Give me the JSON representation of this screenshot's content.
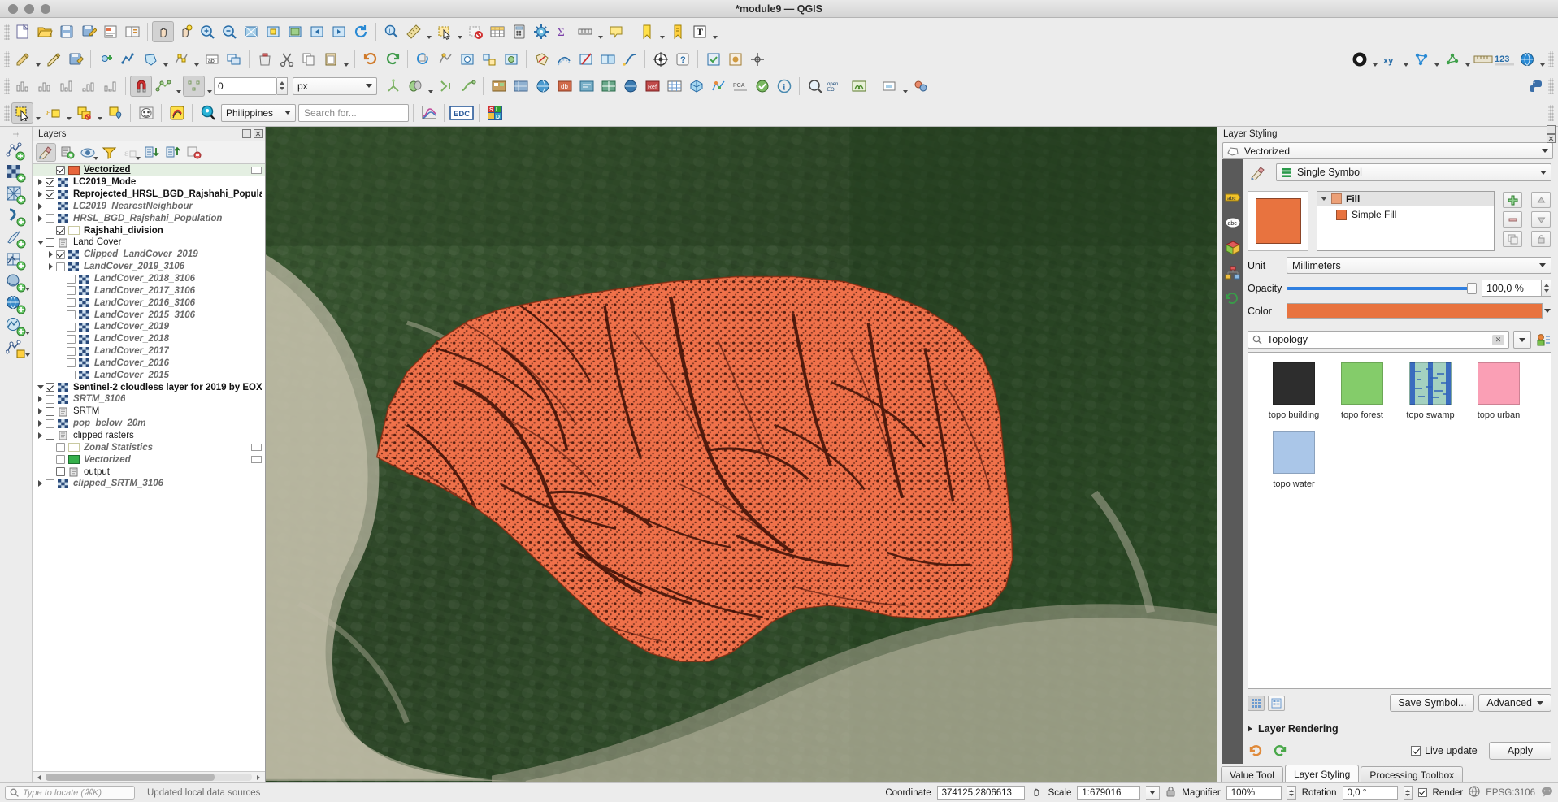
{
  "window": {
    "title": "*module9 — QGIS",
    "traffic_lights": [
      "close",
      "minimize",
      "zoom"
    ]
  },
  "toolbar_row3": {
    "offset_value": "0",
    "units": "px"
  },
  "toolbar_row4": {
    "location_filter": "Philippines",
    "search_placeholder": "Search for...",
    "edc_label": "EDC"
  },
  "layers_panel": {
    "title": "Layers",
    "toolbar": [
      {
        "name": "open-layer-styling-panel",
        "icon": "paintbrush-icon"
      },
      {
        "name": "add-group",
        "icon": "add-group-icon"
      },
      {
        "name": "manage-map-themes",
        "icon": "eye-icon"
      },
      {
        "name": "filter-legend-by-map-content",
        "icon": "filter-icon"
      },
      {
        "name": "filter-legend-by-expression",
        "icon": "expression-icon"
      },
      {
        "name": "expand-all",
        "icon": "expand-all-icon"
      },
      {
        "name": "collapse-all",
        "icon": "collapse-all-icon"
      },
      {
        "name": "remove-layer-group",
        "icon": "remove-layer-icon"
      }
    ],
    "items": [
      {
        "label": "Vectorized",
        "checked": true,
        "style": "bold-underline",
        "indent": 1,
        "expand": "none",
        "swatch": "orange",
        "badge": true
      },
      {
        "label": "LC2019_Mode",
        "checked": true,
        "style": "bold",
        "indent": 0,
        "expand": "closed",
        "swatch": "raster",
        "badge": false
      },
      {
        "label": "Reprojected_HRSL_BGD_Rajshahi_Population",
        "checked": true,
        "style": "bold",
        "indent": 0,
        "expand": "closed",
        "swatch": "raster",
        "badge": false
      },
      {
        "label": "LC2019_NearestNeighbour",
        "checked": false,
        "style": "italic",
        "indent": 0,
        "expand": "closed",
        "swatch": "raster",
        "badge": false
      },
      {
        "label": "HRSL_BGD_Rajshahi_Population",
        "checked": false,
        "style": "italic",
        "indent": 0,
        "expand": "closed",
        "swatch": "raster",
        "badge": false
      },
      {
        "label": "Rajshahi_division",
        "checked": true,
        "style": "bold",
        "indent": 1,
        "expand": "none",
        "swatch": "hollow",
        "badge": false
      },
      {
        "label": "Land Cover",
        "checked": false,
        "style": "plain",
        "indent": 0,
        "expand": "open",
        "swatch": "group",
        "badge": false
      },
      {
        "label": "Clipped_LandCover_2019",
        "checked": true,
        "style": "italic",
        "indent": 1,
        "expand": "closed",
        "swatch": "raster",
        "badge": false
      },
      {
        "label": "LandCover_2019_3106",
        "checked": false,
        "style": "italic",
        "indent": 1,
        "expand": "closed",
        "swatch": "raster",
        "badge": false
      },
      {
        "label": "LandCover_2018_3106",
        "checked": false,
        "style": "italic",
        "indent": 2,
        "expand": "none",
        "swatch": "raster",
        "badge": false
      },
      {
        "label": "LandCover_2017_3106",
        "checked": false,
        "style": "italic",
        "indent": 2,
        "expand": "none",
        "swatch": "raster",
        "badge": false
      },
      {
        "label": "LandCover_2016_3106",
        "checked": false,
        "style": "italic",
        "indent": 2,
        "expand": "none",
        "swatch": "raster",
        "badge": false
      },
      {
        "label": "LandCover_2015_3106",
        "checked": false,
        "style": "italic",
        "indent": 2,
        "expand": "none",
        "swatch": "raster",
        "badge": false
      },
      {
        "label": "LandCover_2019",
        "checked": false,
        "style": "italic",
        "indent": 2,
        "expand": "none",
        "swatch": "raster",
        "badge": false
      },
      {
        "label": "LandCover_2018",
        "checked": false,
        "style": "italic",
        "indent": 2,
        "expand": "none",
        "swatch": "raster",
        "badge": false
      },
      {
        "label": "LandCover_2017",
        "checked": false,
        "style": "italic",
        "indent": 2,
        "expand": "none",
        "swatch": "raster",
        "badge": false
      },
      {
        "label": "LandCover_2016",
        "checked": false,
        "style": "italic",
        "indent": 2,
        "expand": "none",
        "swatch": "raster",
        "badge": false
      },
      {
        "label": "LandCover_2015",
        "checked": false,
        "style": "italic",
        "indent": 2,
        "expand": "none",
        "swatch": "raster",
        "badge": false
      },
      {
        "label": "Sentinel-2 cloudless layer for 2019 by EOX",
        "checked": true,
        "style": "bold",
        "indent": 0,
        "expand": "open",
        "swatch": "raster",
        "badge": false
      },
      {
        "label": "SRTM_3106",
        "checked": false,
        "style": "italic",
        "indent": 0,
        "expand": "closed",
        "swatch": "raster",
        "badge": false
      },
      {
        "label": "SRTM",
        "checked": false,
        "style": "plain",
        "indent": 0,
        "expand": "closed",
        "swatch": "group",
        "badge": false
      },
      {
        "label": "pop_below_20m",
        "checked": false,
        "style": "italic",
        "indent": 0,
        "expand": "closed",
        "swatch": "raster",
        "badge": false
      },
      {
        "label": "clipped rasters",
        "checked": false,
        "style": "plain",
        "indent": 0,
        "expand": "closed",
        "swatch": "group",
        "badge": false
      },
      {
        "label": "Zonal Statistics",
        "checked": false,
        "style": "italic",
        "indent": 1,
        "expand": "none",
        "swatch": "hollow",
        "badge": true
      },
      {
        "label": "Vectorized",
        "checked": false,
        "style": "italic",
        "indent": 1,
        "expand": "none",
        "swatch": "green",
        "badge": true
      },
      {
        "label": "output",
        "checked": false,
        "style": "plain",
        "indent": 1,
        "expand": "none",
        "swatch": "group",
        "badge": false
      },
      {
        "label": "clipped_SRTM_3106",
        "checked": false,
        "style": "italic",
        "indent": 0,
        "expand": "closed",
        "swatch": "raster",
        "badge": false
      }
    ]
  },
  "layer_styling": {
    "title": "Layer Styling",
    "current_layer": "Vectorized",
    "renderer": "Single Symbol",
    "symbol_tree": {
      "root": "Fill",
      "child": "Simple Fill"
    },
    "unit_label": "Unit",
    "unit_value": "Millimeters",
    "opacity_label": "Opacity",
    "opacity_value": "100,0 %",
    "color_label": "Color",
    "color_hex": "#e8733f",
    "search_value": "Topology",
    "symbols": [
      {
        "name": "topo building",
        "color": "#2d2d2d",
        "pattern": "solid"
      },
      {
        "name": "topo forest",
        "color": "#84cc6a",
        "pattern": "solid"
      },
      {
        "name": "topo swamp",
        "color": "#a4d1c0",
        "pattern": "swamp"
      },
      {
        "name": "topo urban",
        "color": "#fa9fb5",
        "pattern": "solid"
      },
      {
        "name": "topo water",
        "color": "#aac6e8",
        "pattern": "solid"
      }
    ],
    "save_symbol_label": "Save Symbol...",
    "advanced_label": "Advanced",
    "layer_rendering_label": "Layer Rendering",
    "live_update_label": "Live update",
    "apply_label": "Apply"
  },
  "dock_tabs": [
    {
      "label": "Value Tool",
      "active": false
    },
    {
      "label": "Layer Styling",
      "active": true
    },
    {
      "label": "Processing Toolbox",
      "active": false
    }
  ],
  "statusbar": {
    "locator_placeholder": "Type to locate (⌘K)",
    "message": "Updated local data sources",
    "coordinate_label": "Coordinate",
    "coordinate_value": "374125,2806613",
    "scale_label": "Scale",
    "scale_value": "1:679016",
    "magnifier_label": "Magnifier",
    "magnifier_value": "100%",
    "rotation_label": "Rotation",
    "rotation_value": "0,0 °",
    "render_label": "Render",
    "crs_label": "EPSG:3106"
  },
  "map": {
    "basemap": "Sentinel-2 cloudless satellite imagery",
    "vector_overlay_color": "#f0714a",
    "vector_outline_color": "#4a1208"
  }
}
